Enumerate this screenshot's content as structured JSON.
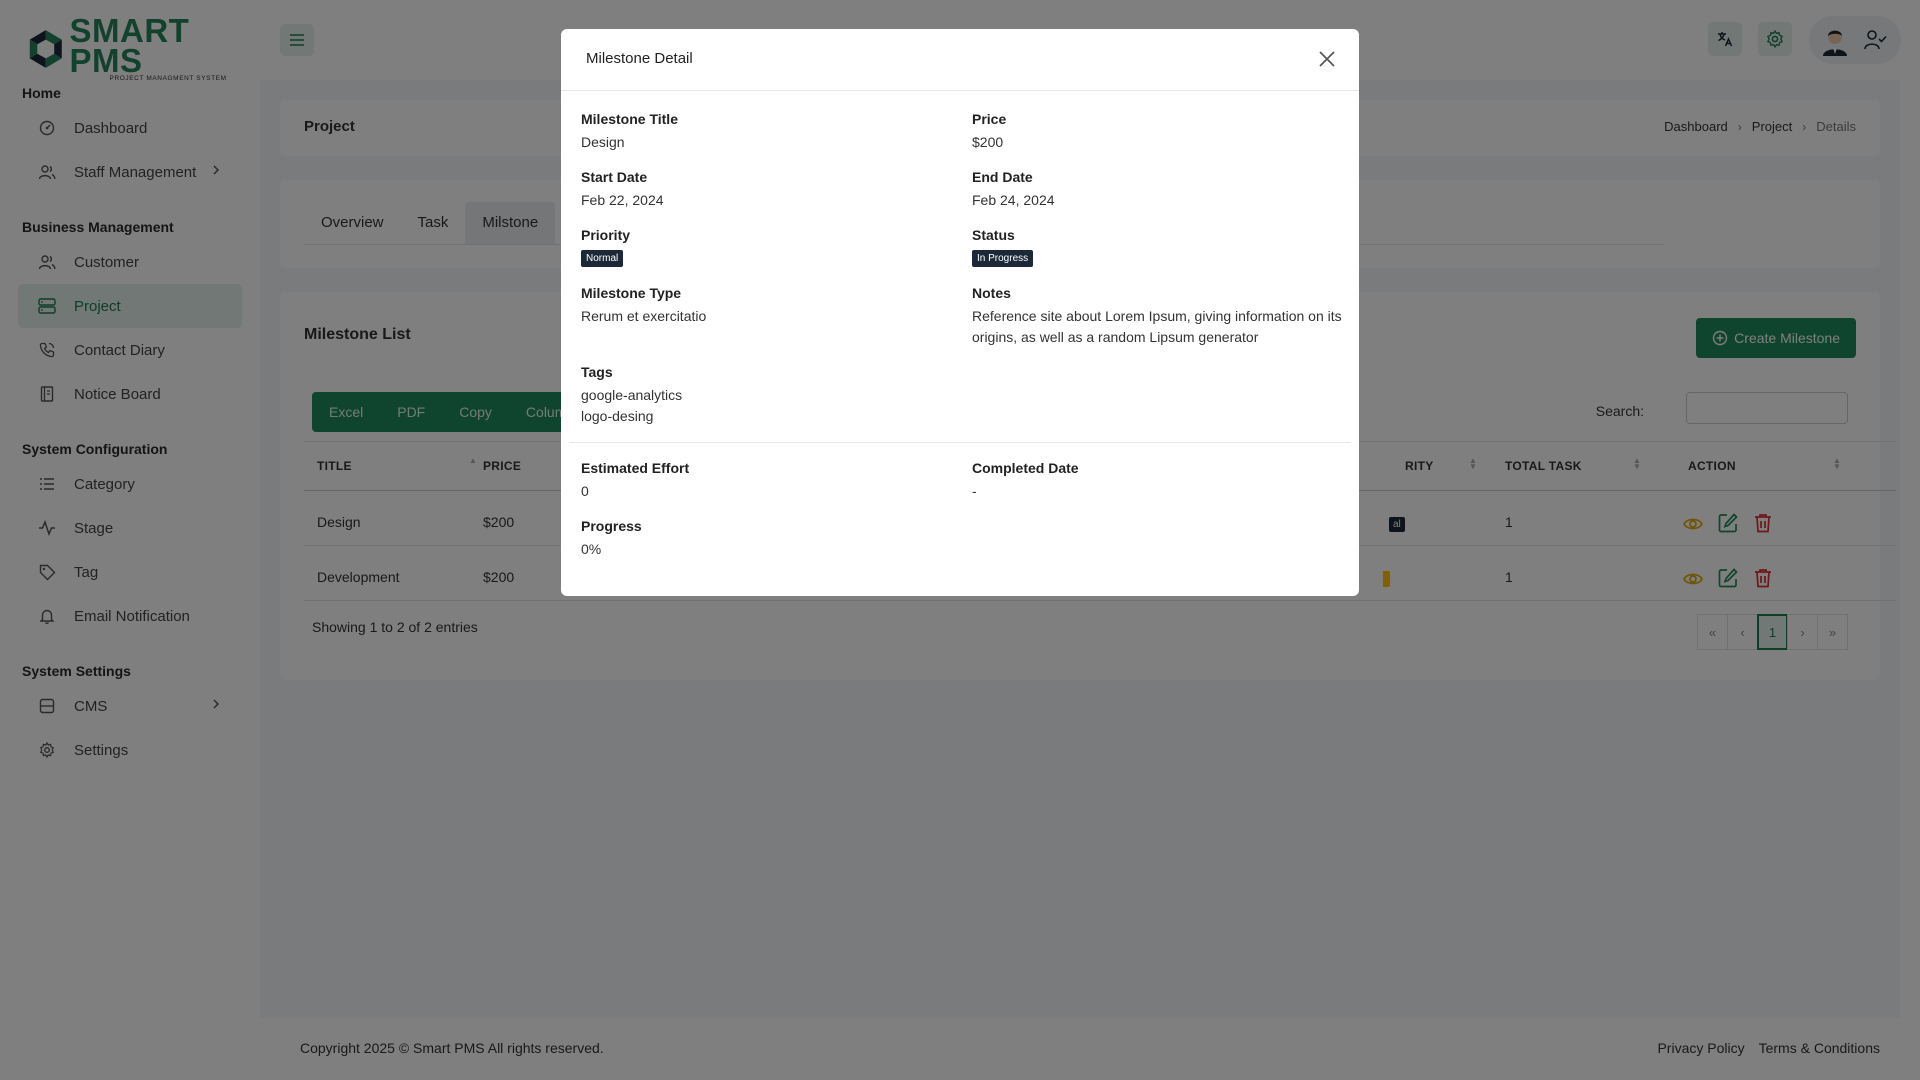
{
  "brand": {
    "name": "SMART PMS",
    "tagline": "PROJECT MANAGMENT SYSTEM"
  },
  "sidebar": {
    "sections": [
      {
        "title": "Home",
        "items": [
          {
            "label": "Dashboard"
          },
          {
            "label": "Staff Management"
          }
        ]
      },
      {
        "title": "Business Management",
        "items": [
          {
            "label": "Customer"
          },
          {
            "label": "Project"
          },
          {
            "label": "Contact Diary"
          },
          {
            "label": "Notice Board"
          }
        ]
      },
      {
        "title": "System Configuration",
        "items": [
          {
            "label": "Category"
          },
          {
            "label": "Stage"
          },
          {
            "label": "Tag"
          },
          {
            "label": "Email Notification"
          }
        ]
      },
      {
        "title": "System Settings",
        "items": [
          {
            "label": "CMS"
          },
          {
            "label": "Settings"
          }
        ]
      }
    ]
  },
  "page": {
    "title": "Project",
    "breadcrumb": [
      "Dashboard",
      "Project",
      "Details"
    ]
  },
  "tabs": [
    "Overview",
    "Task",
    "Milstone"
  ],
  "milestone_list": {
    "title": "Milestone List",
    "create_label": "Create Milestone",
    "export_buttons": [
      "Excel",
      "PDF",
      "Copy",
      "Colum"
    ],
    "search_label": "Search:",
    "columns": [
      "TITLE",
      "PRICE",
      "RITY",
      "TOTAL TASK",
      "ACTION"
    ],
    "rows": [
      {
        "title": "Design",
        "price": "$200",
        "priority": "al",
        "total_task": "1"
      },
      {
        "title": "Development",
        "price": "$200",
        "priority": "",
        "total_task": "1"
      }
    ],
    "entries_text": "Showing 1 to 2 of 2 entries",
    "pager": [
      "«",
      "‹",
      "1",
      "›",
      "»"
    ]
  },
  "footer": {
    "copyright": "Copyright 2025 © Smart PMS All rights reserved.",
    "links": [
      "Privacy Policy",
      "Terms & Conditions"
    ]
  },
  "modal": {
    "title": "Milestone Detail",
    "fields": {
      "milestone_title": {
        "label": "Milestone Title",
        "value": "Design"
      },
      "price": {
        "label": "Price",
        "value": "$200"
      },
      "start_date": {
        "label": "Start Date",
        "value": "Feb 22, 2024"
      },
      "end_date": {
        "label": "End Date",
        "value": "Feb 24, 2024"
      },
      "priority": {
        "label": "Priority",
        "value": "Normal"
      },
      "status": {
        "label": "Status",
        "value": "In Progress"
      },
      "milestone_type": {
        "label": "Milestone Type",
        "value": "Rerum et exercitatio"
      },
      "notes": {
        "label": "Notes",
        "value": "Reference site about Lorem Ipsum, giving information on its origins, as well as a random Lipsum generator"
      },
      "tags": {
        "label": "Tags",
        "values": [
          "google-analytics",
          "logo-desing"
        ]
      },
      "estimated_effort": {
        "label": "Estimated Effort",
        "value": "0"
      },
      "completed_date": {
        "label": "Completed Date",
        "value": "-"
      },
      "progress": {
        "label": "Progress",
        "value": "0%"
      }
    }
  },
  "colors": {
    "primary": "#1f8a5c",
    "primary_light": "#e3f1ea",
    "badge": "#1c2838",
    "eye": "#e0a800",
    "edit": "#1f8a5c",
    "delete": "#d63333"
  },
  "icons": {
    "nav": [
      "dashboard-icon",
      "staff-icon",
      "customer-icon",
      "project-icon",
      "contact-diary-icon",
      "notice-board-icon",
      "category-icon",
      "stage-icon",
      "tag-icon",
      "bell-icon",
      "cms-icon",
      "gear-icon"
    ],
    "header": [
      "hamburger-icon",
      "translate-icon",
      "gear-icon",
      "avatar",
      "user-check-icon"
    ],
    "actions": [
      "eye-icon",
      "edit-icon",
      "trash-icon"
    ]
  }
}
